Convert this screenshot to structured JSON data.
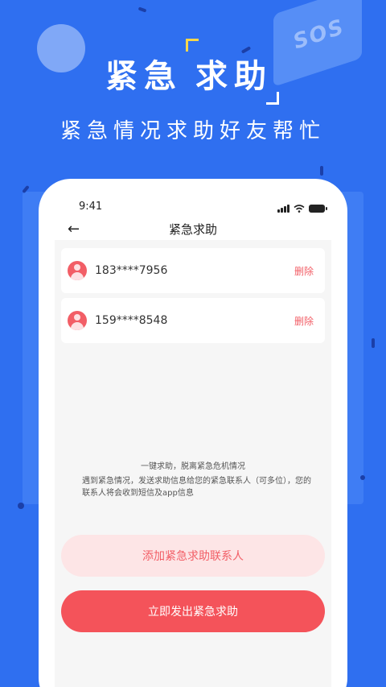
{
  "promo": {
    "headline_part1": "紧急",
    "headline_part2": "求助",
    "subline": "紧急情况求助好友帮忙",
    "sos_text": "SOS"
  },
  "status_bar": {
    "time": "9:41"
  },
  "navbar": {
    "title": "紧急求助",
    "back_icon": "←"
  },
  "contacts": [
    {
      "phone": "183****7956",
      "delete_label": "删除"
    },
    {
      "phone": "159****8548",
      "delete_label": "删除"
    }
  ],
  "tips": {
    "line1": "一键求助，脱离紧急危机情况",
    "line2": "遇到紧急情况，发送求助信息给您的紧急联系人（可多位），您的联系人将会收到短信及app信息"
  },
  "buttons": {
    "add_contact": "添加紧急求助联系人",
    "send_sos": "立即发出紧急求助"
  },
  "colors": {
    "background": "#2f6ff0",
    "accent_red": "#f4535a",
    "light_red": "#fde5e6",
    "bracket_yellow": "#f7d64a"
  }
}
